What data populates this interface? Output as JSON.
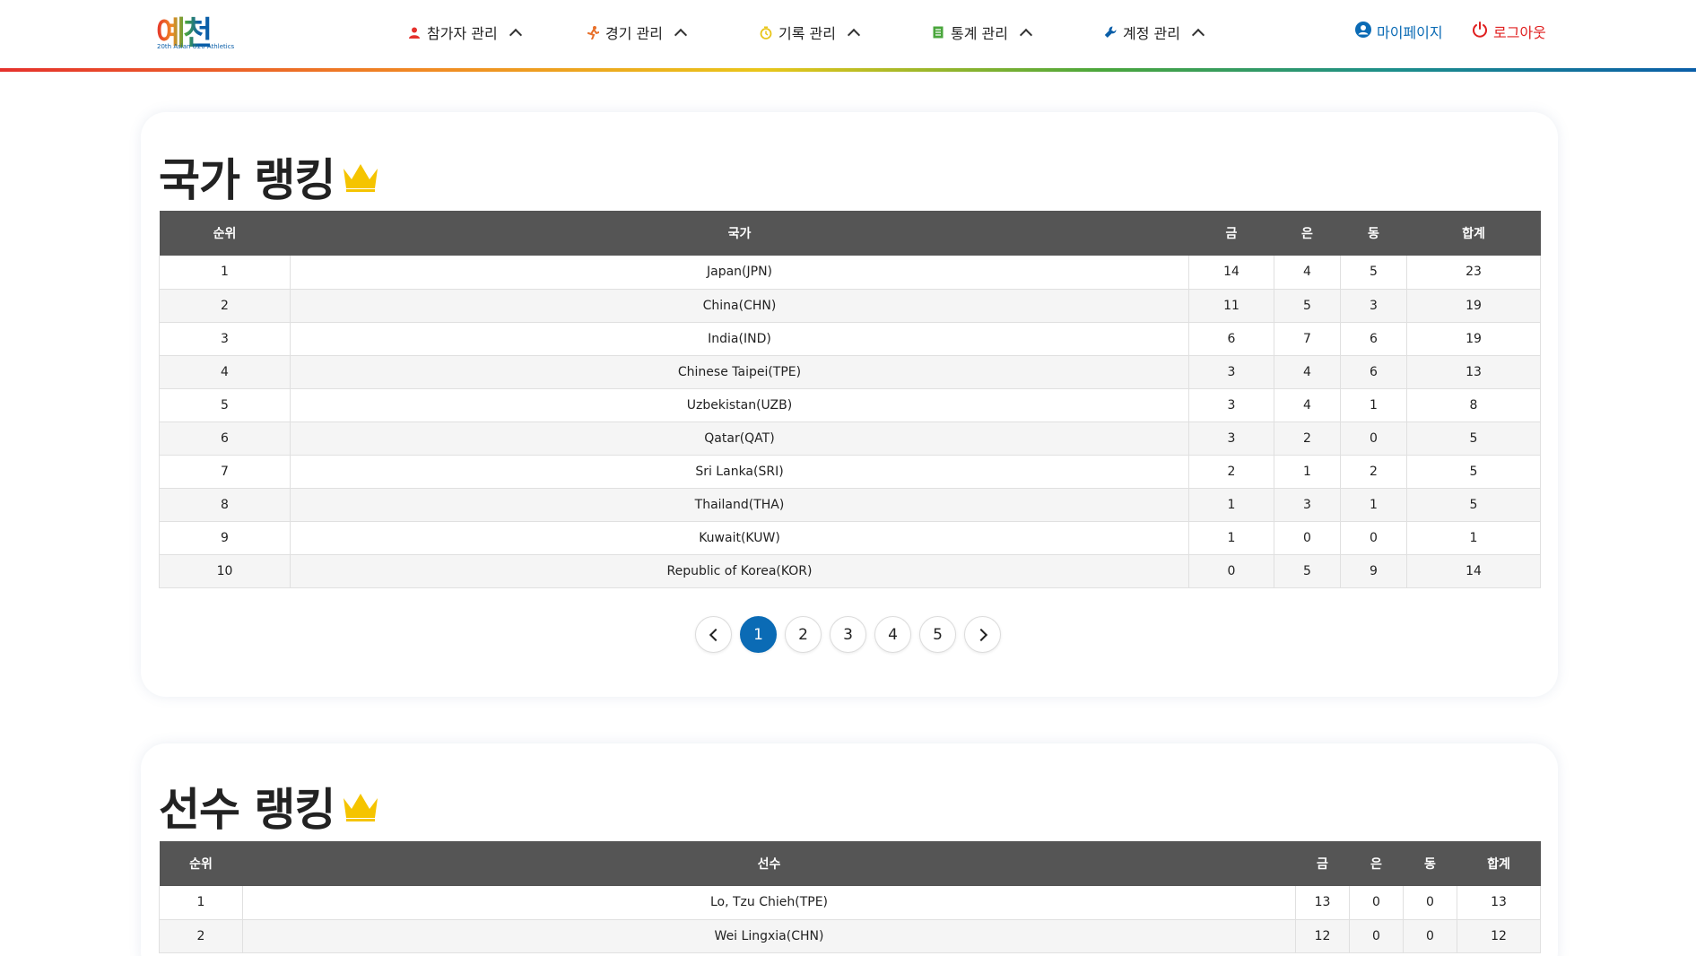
{
  "header": {
    "logo_text": "예천",
    "logo_sub": "20th Asian U20 Athletics",
    "nav": [
      {
        "label": "참가자 관리",
        "icon": "person-icon"
      },
      {
        "label": "경기 관리",
        "icon": "runner-icon"
      },
      {
        "label": "기록 관리",
        "icon": "stopwatch-icon"
      },
      {
        "label": "통계 관리",
        "icon": "document-icon"
      },
      {
        "label": "계정 관리",
        "icon": "wrench-icon"
      }
    ],
    "mypage_label": "마이페이지",
    "logout_label": "로그아웃",
    "colors": {
      "mypage": "#0b6bb5",
      "logout": "#e02020"
    }
  },
  "country_ranking": {
    "title": "국가 랭킹",
    "columns": [
      "순위",
      "국가",
      "금",
      "은",
      "동",
      "합계"
    ],
    "rows": [
      [
        "1",
        "Japan(JPN)",
        "14",
        "4",
        "5",
        "23"
      ],
      [
        "2",
        "China(CHN)",
        "11",
        "5",
        "3",
        "19"
      ],
      [
        "3",
        "India(IND)",
        "6",
        "7",
        "6",
        "19"
      ],
      [
        "4",
        "Chinese Taipei(TPE)",
        "3",
        "4",
        "6",
        "13"
      ],
      [
        "5",
        "Uzbekistan(UZB)",
        "3",
        "4",
        "1",
        "8"
      ],
      [
        "6",
        "Qatar(QAT)",
        "3",
        "2",
        "0",
        "5"
      ],
      [
        "7",
        "Sri Lanka(SRI)",
        "2",
        "1",
        "2",
        "5"
      ],
      [
        "8",
        "Thailand(THA)",
        "1",
        "3",
        "1",
        "5"
      ],
      [
        "9",
        "Kuwait(KUW)",
        "1",
        "0",
        "0",
        "1"
      ],
      [
        "10",
        "Republic of Korea(KOR)",
        "0",
        "5",
        "9",
        "14"
      ]
    ],
    "pagination": {
      "pages": [
        "1",
        "2",
        "3",
        "4",
        "5"
      ],
      "current": "1"
    }
  },
  "athlete_ranking": {
    "title": "선수 랭킹",
    "columns": [
      "순위",
      "선수",
      "금",
      "은",
      "동",
      "합계"
    ],
    "rows": [
      [
        "1",
        "Lo, Tzu Chieh(TPE)",
        "13",
        "0",
        "0",
        "13"
      ],
      [
        "2",
        "Wei Lingxia(CHN)",
        "12",
        "0",
        "0",
        "12"
      ]
    ]
  }
}
